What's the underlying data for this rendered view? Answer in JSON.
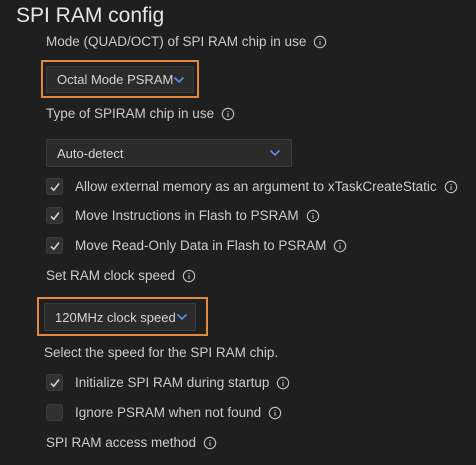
{
  "section": {
    "title": "SPI RAM config"
  },
  "mode": {
    "label": "Mode (QUAD/OCT) of SPI RAM chip in use",
    "value": "Octal Mode PSRAM"
  },
  "chip_type": {
    "label": "Type of SPIRAM chip in use",
    "value": "Auto-detect"
  },
  "checks_top": [
    {
      "label": "Allow external memory as an argument to xTaskCreateStatic",
      "checked": true
    },
    {
      "label": "Move Instructions in Flash to PSRAM",
      "checked": true
    },
    {
      "label": "Move Read-Only Data in Flash to PSRAM",
      "checked": true
    }
  ],
  "clock": {
    "label": "Set RAM clock speed",
    "value": "120MHz clock speed",
    "description": "Select the speed for the SPI RAM chip."
  },
  "checks_bottom": [
    {
      "label": "Initialize SPI RAM during startup",
      "checked": true
    },
    {
      "label": "Ignore PSRAM when not found",
      "checked": false
    }
  ],
  "access": {
    "label": "SPI RAM access method"
  },
  "colors": {
    "background": "#1f1f1f",
    "highlight_border": "#e0893f",
    "chevron": "#5b8ef0",
    "text": "#cccccc"
  },
  "icons": {
    "info": "info-icon",
    "dropdown": "chevron-down-icon",
    "check": "check-icon"
  }
}
